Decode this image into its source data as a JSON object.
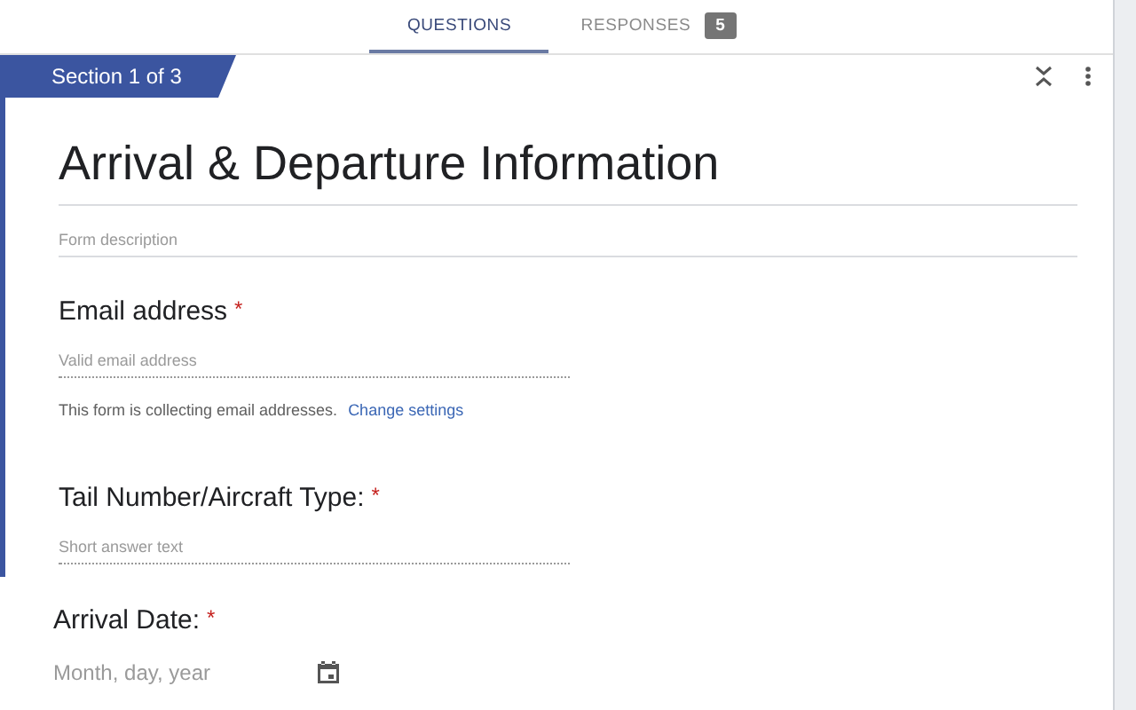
{
  "tabs": [
    {
      "label": "QUESTIONS",
      "selected": true
    },
    {
      "label": "RESPONSES",
      "selected": false,
      "badge": "5"
    }
  ],
  "section": {
    "label": "Section 1 of 3"
  },
  "form": {
    "title": "Arrival & Departure Information",
    "description_placeholder": "Form description"
  },
  "questions": [
    {
      "kind": "email",
      "title": "Email address",
      "required_mark": "*",
      "placeholder": "Valid email address",
      "note": "This form is collecting email addresses.",
      "link": "Change settings"
    },
    {
      "kind": "short",
      "title": "Tail Number/Aircraft Type:",
      "required_mark": "*",
      "placeholder": "Short answer text"
    },
    {
      "kind": "date",
      "title": "Arrival Date:",
      "required_mark": "*",
      "placeholder": "Month, day, year"
    }
  ]
}
